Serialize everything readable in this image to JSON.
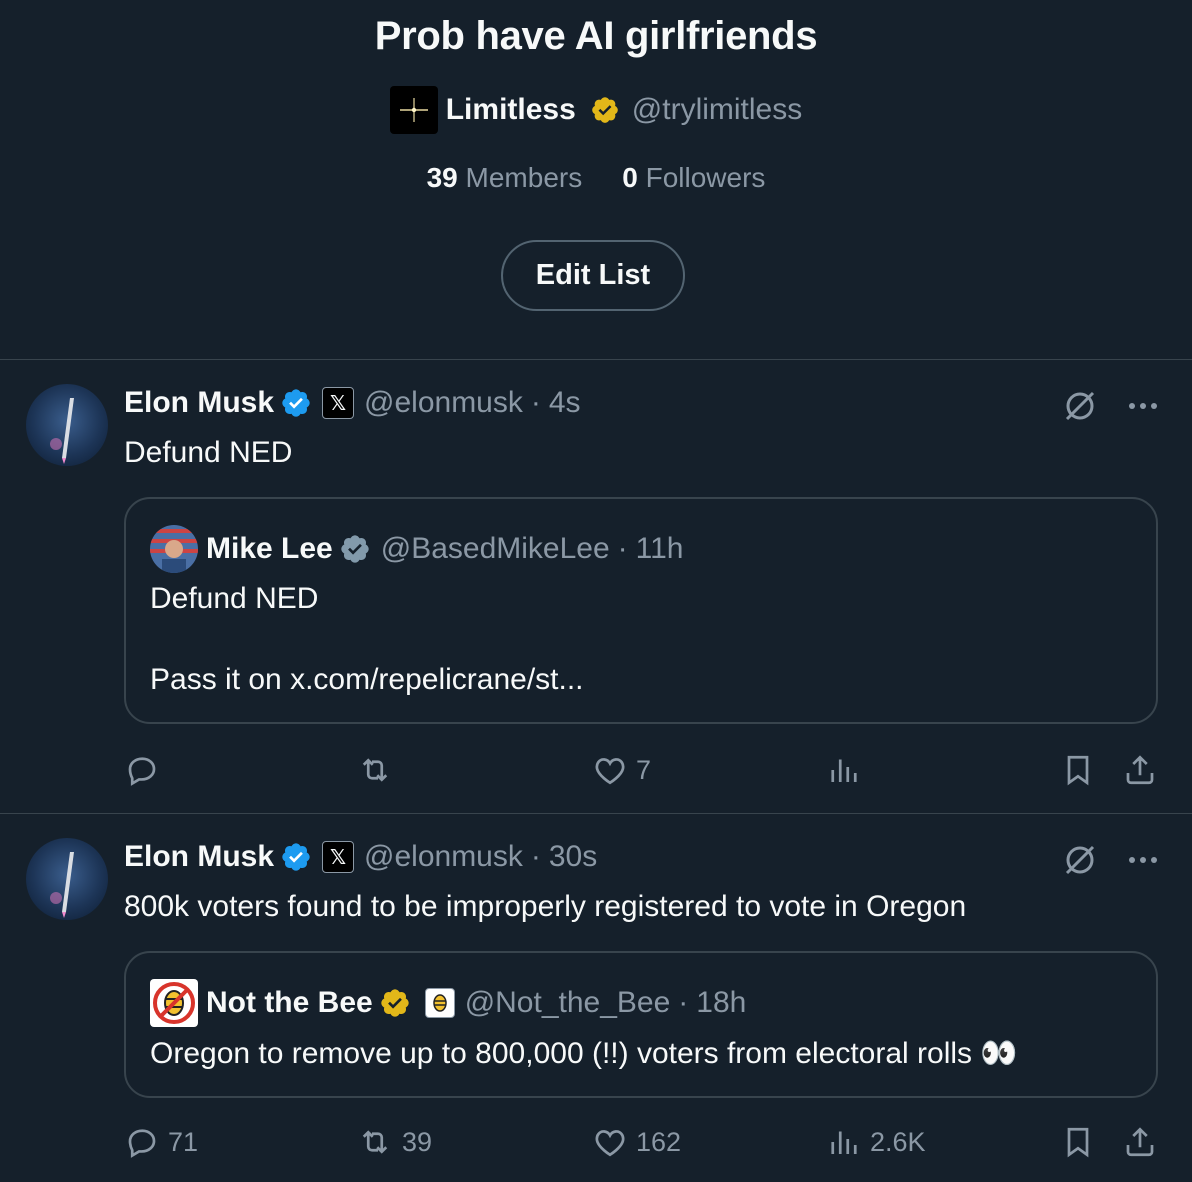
{
  "list": {
    "title": "Prob have AI girlfriends",
    "owner_name": "Limitless",
    "owner_handle": "@trylimitless",
    "members_count": "39",
    "members_label": "Members",
    "followers_count": "0",
    "followers_label": "Followers",
    "edit_button": "Edit List"
  },
  "tweets": [
    {
      "author_name": "Elon Musk",
      "affiliation": "𝕏",
      "handle": "@elonmusk",
      "time": "4s",
      "text": "Defund NED",
      "quote": {
        "author_name": "Mike Lee",
        "handle": "@BasedMikeLee",
        "time": "11h",
        "text_line1": "Defund NED",
        "text_line2": "Pass it on x.com/repelicrane/st..."
      },
      "stats": {
        "replies": "",
        "reposts": "",
        "likes": "7",
        "views": ""
      }
    },
    {
      "author_name": "Elon Musk",
      "affiliation": "𝕏",
      "handle": "@elonmusk",
      "time": "30s",
      "text": "800k voters found to be improperly registered to vote in Oregon",
      "quote": {
        "author_name": "Not the Bee",
        "handle": "@Not_the_Bee",
        "time": "18h",
        "text_line1": "Oregon to remove up to 800,000 (!!) voters from electoral rolls",
        "emoji": "👀"
      },
      "stats": {
        "replies": "71",
        "reposts": "39",
        "likes": "162",
        "views": "2.6K"
      }
    }
  ],
  "colors": {
    "background": "#15202b",
    "text_primary": "#f7f9f9",
    "text_secondary": "#8b98a5",
    "border": "#38444d",
    "verified_blue": "#1d9bf0",
    "verified_gold": "#e2b719",
    "verified_gray": "#829aab"
  }
}
